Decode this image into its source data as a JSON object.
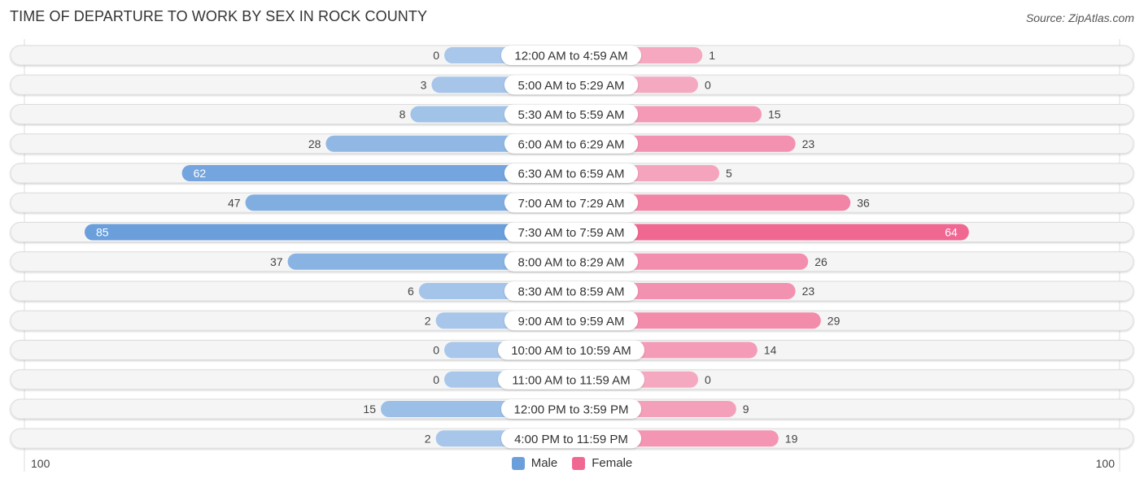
{
  "title": "TIME OF DEPARTURE TO WORK BY SEX IN ROCK COUNTY",
  "source": "Source: ZipAtlas.com",
  "colors": {
    "male": "#6a9fdc",
    "male_light": "#a9c7ea",
    "female": "#f06892",
    "female_light": "#f5a9c1"
  },
  "axis": {
    "left_label": "100",
    "right_label": "100"
  },
  "legend": {
    "male": "Male",
    "female": "Female"
  },
  "chart_data": {
    "type": "bar",
    "title": "TIME OF DEPARTURE TO WORK BY SEX IN ROCK COUNTY",
    "orientation": "horizontal-diverging",
    "categories": [
      "12:00 AM to 4:59 AM",
      "5:00 AM to 5:29 AM",
      "5:30 AM to 5:59 AM",
      "6:00 AM to 6:29 AM",
      "6:30 AM to 6:59 AM",
      "7:00 AM to 7:29 AM",
      "7:30 AM to 7:59 AM",
      "8:00 AM to 8:29 AM",
      "8:30 AM to 8:59 AM",
      "9:00 AM to 9:59 AM",
      "10:00 AM to 10:59 AM",
      "11:00 AM to 11:59 AM",
      "12:00 PM to 3:59 PM",
      "4:00 PM to 11:59 PM"
    ],
    "series": [
      {
        "name": "Male",
        "values": [
          0,
          3,
          8,
          28,
          62,
          47,
          85,
          37,
          6,
          2,
          0,
          0,
          15,
          2
        ]
      },
      {
        "name": "Female",
        "values": [
          1,
          0,
          15,
          23,
          5,
          36,
          64,
          26,
          23,
          29,
          14,
          0,
          9,
          19
        ]
      }
    ],
    "xlim": [
      -100,
      100
    ],
    "xlabel": "",
    "ylabel": "",
    "legend_position": "bottom-center"
  }
}
